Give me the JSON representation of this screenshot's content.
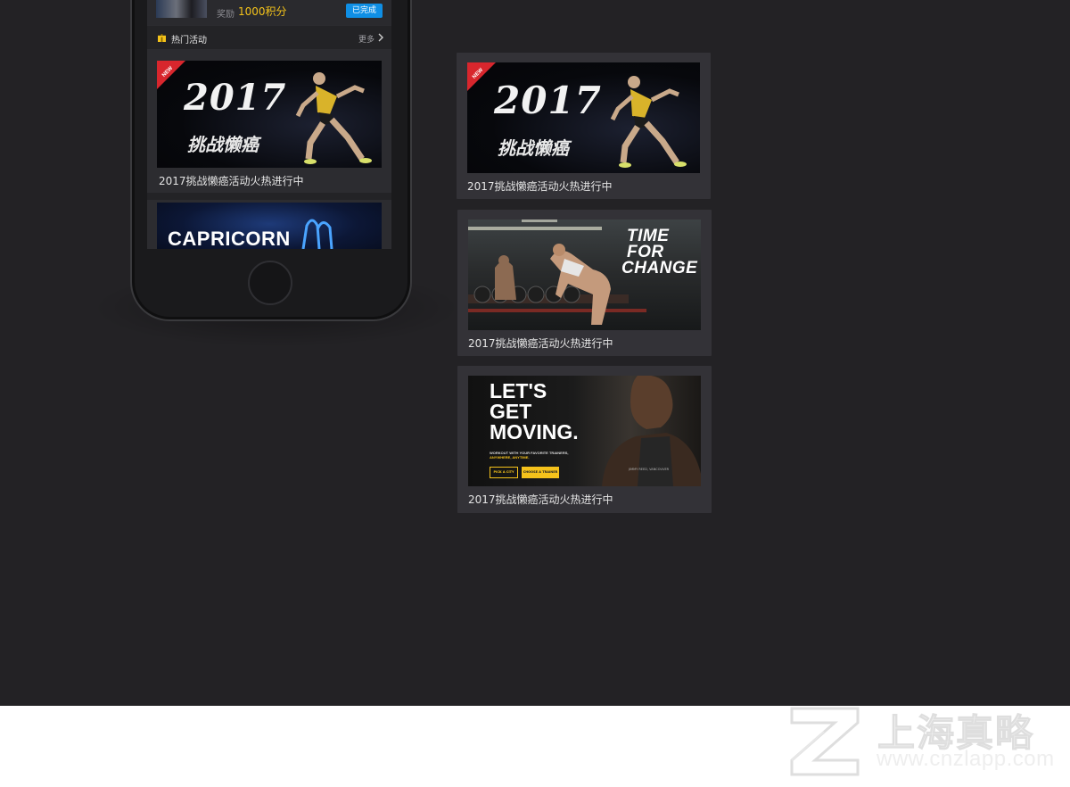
{
  "phone": {
    "task_row": {
      "reward_label": "奖励",
      "reward_value": "1000积分",
      "status_badge": "已完成"
    },
    "section": {
      "title": "热门活动",
      "more": "更多"
    },
    "cards": [
      {
        "banner_year": "2017",
        "banner_sub": "挑战懒癌",
        "ribbon": "NEW",
        "caption": "2017挑战懒癌活动火热进行中"
      },
      {
        "banner_text": "CAPRICORN"
      }
    ]
  },
  "cards": [
    {
      "banner_year": "2017",
      "banner_sub": "挑战懒癌",
      "ribbon": "NEW",
      "caption": "2017挑战懒癌活动火热进行中"
    },
    {
      "banner_lines": [
        "TIME",
        "FOR",
        "CHANGE"
      ],
      "caption": "2017挑战懒癌活动火热进行中"
    },
    {
      "banner_lines": [
        "LET'S",
        "GET",
        "MOVING."
      ],
      "tagline": "WORKOUT WITH YOUR FAVORITE TRAINERS,",
      "tagline_highlight": "ANYWHERE, ANYTIME.",
      "button_city": "PICK A CITY",
      "button_trainer": "CHOOSE A TRAINER",
      "signature": "JIMMY REED, VANCOUVER",
      "caption": "2017挑战懒癌活动火热进行中"
    }
  ],
  "watermark": {
    "brand_cn": "上海真略",
    "url": "www.cnzlapp.com"
  },
  "colors": {
    "background": "#232225",
    "card": "#333237",
    "accent_yellow": "#f4c31b",
    "badge_blue": "#0f8fe5",
    "ribbon_red": "#d8262d"
  }
}
